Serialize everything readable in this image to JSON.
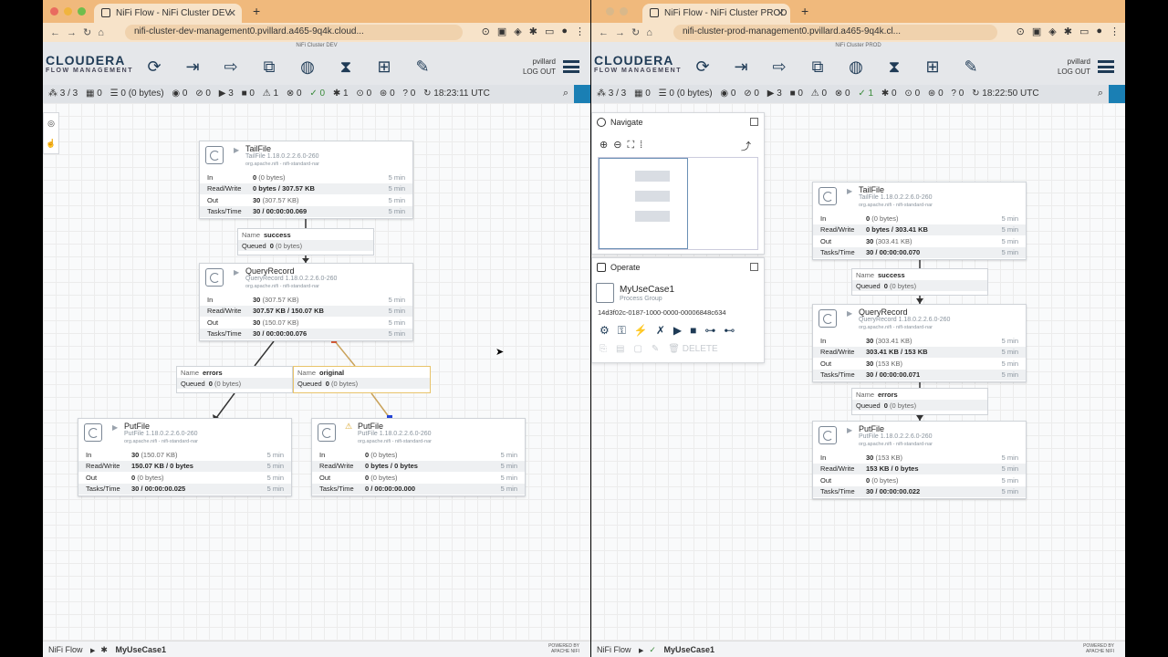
{
  "left": {
    "tab_title": "NiFi Flow - NiFi Cluster DEV",
    "url": "nifi-cluster-dev-management0.pvillard.a465-9q4k.cloud...",
    "cluster_label": "NiFi Cluster DEV",
    "user": "pvillard",
    "logout": "LOG OUT",
    "status": {
      "nodes": "3 / 3",
      "threads": "0",
      "queued": "0 (0 bytes)",
      "transmitting": "0",
      "not_transmitting": "0",
      "running": "3",
      "stopped": "0",
      "invalid": "1",
      "disabled": "0",
      "up_to_date": "0",
      "locally_modified": "1",
      "stale": "0",
      "modified_stale": "0",
      "sync_failure": "0",
      "time": "18:23:11 UTC"
    },
    "breadcrumb_root": "NiFi Flow",
    "breadcrumb_current": "MyUseCase1",
    "processors": [
      {
        "name": "TailFile",
        "type": "TailFile 1.18.0.2.2.6.0-260",
        "bundle": "org.apache.nifi - nifi-standard-nar",
        "in": "0",
        "in_b": "(0 bytes)",
        "rw": "0 bytes / 307.57 KB",
        "out": "30",
        "out_b": "(307.57 KB)",
        "tasks": "30 / 00:00:00.069"
      },
      {
        "name": "QueryRecord",
        "type": "QueryRecord 1.18.0.2.2.6.0-260",
        "bundle": "org.apache.nifi - nifi-standard-nar",
        "in": "30",
        "in_b": "(307.57 KB)",
        "rw": "307.57 KB / 150.07 KB",
        "out": "30",
        "out_b": "(150.07 KB)",
        "tasks": "30 / 00:00:00.076"
      },
      {
        "name": "PutFile",
        "type": "PutFile 1.18.0.2.2.6.0-260",
        "bundle": "org.apache.nifi - nifi-standard-nar",
        "in": "30",
        "in_b": "(150.07 KB)",
        "rw": "150.07 KB / 0 bytes",
        "out": "0",
        "out_b": "(0 bytes)",
        "tasks": "30 / 00:00:00.025"
      },
      {
        "name": "PutFile",
        "type": "PutFile 1.18.0.2.2.6.0-260",
        "bundle": "org.apache.nifi - nifi-standard-nar",
        "in": "0",
        "in_b": "(0 bytes)",
        "rw": "0 bytes / 0 bytes",
        "out": "0",
        "out_b": "(0 bytes)",
        "tasks": "0 / 00:00:00.000"
      }
    ],
    "connections": [
      {
        "name": "success",
        "queued": "0",
        "queued_b": "(0 bytes)"
      },
      {
        "name": "errors",
        "queued": "0",
        "queued_b": "(0 bytes)"
      },
      {
        "name": "original",
        "queued": "0",
        "queued_b": "(0 bytes)"
      }
    ]
  },
  "right": {
    "tab_title": "NiFi Flow - NiFi Cluster PROD",
    "url": "nifi-cluster-prod-management0.pvillard.a465-9q4k.cl...",
    "cluster_label": "NiFi Cluster PROD",
    "user": "pvillard",
    "logout": "LOG OUT",
    "status": {
      "nodes": "3 / 3",
      "threads": "0",
      "queued": "0 (0 bytes)",
      "transmitting": "0",
      "not_transmitting": "0",
      "running": "3",
      "stopped": "0",
      "invalid": "0",
      "disabled": "0",
      "up_to_date": "1",
      "locally_modified": "0",
      "stale": "0",
      "modified_stale": "0",
      "sync_failure": "0",
      "time": "18:22:50 UTC"
    },
    "breadcrumb_root": "NiFi Flow",
    "breadcrumb_current": "MyUseCase1",
    "navigate_title": "Navigate",
    "operate_title": "Operate",
    "operate_name": "MyUseCase1",
    "operate_type": "Process Group",
    "operate_id": "14d3f02c-0187-1000-0000-00006848c634",
    "delete_label": "DELETE",
    "processors": [
      {
        "name": "TailFile",
        "type": "TailFile 1.18.0.2.2.6.0-260",
        "bundle": "org.apache.nifi - nifi-standard-nar",
        "in": "0",
        "in_b": "(0 bytes)",
        "rw": "0 bytes / 303.41 KB",
        "out": "30",
        "out_b": "(303.41 KB)",
        "tasks": "30 / 00:00:00.070"
      },
      {
        "name": "QueryRecord",
        "type": "QueryRecord 1.18.0.2.2.6.0-260",
        "bundle": "org.apache.nifi - nifi-standard-nar",
        "in": "30",
        "in_b": "(303.41 KB)",
        "rw": "303.41 KB / 153 KB",
        "out": "30",
        "out_b": "(153 KB)",
        "tasks": "30 / 00:00:00.071"
      },
      {
        "name": "PutFile",
        "type": "PutFile 1.18.0.2.2.6.0-260",
        "bundle": "org.apache.nifi - nifi-standard-nar",
        "in": "30",
        "in_b": "(153 KB)",
        "rw": "153 KB / 0 bytes",
        "out": "0",
        "out_b": "(0 bytes)",
        "tasks": "30 / 00:00:00.022"
      }
    ],
    "connections": [
      {
        "name": "success",
        "queued": "0",
        "queued_b": "(0 bytes)"
      },
      {
        "name": "errors",
        "queued": "0",
        "queued_b": "(0 bytes)"
      }
    ]
  },
  "labels": {
    "in": "In",
    "rw": "Read/Write",
    "out": "Out",
    "tasks": "Tasks/Time",
    "five_min": "5 min",
    "name": "Name",
    "queued": "Queued",
    "logo": "CLOUDERA",
    "logo_sub": "FLOW MANAGEMENT",
    "powered": "POWERED BY",
    "apache_nifi": "APACHE NIFI"
  },
  "icons": [
    "refresh-icon",
    "search-icon",
    "gear-icon",
    "play-icon",
    "stop-icon",
    "warning-icon",
    "hamburger-icon"
  ]
}
